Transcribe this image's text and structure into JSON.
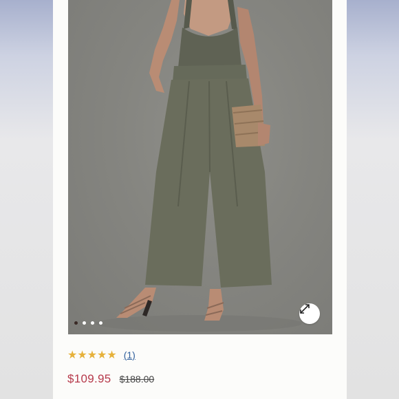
{
  "product": {
    "rating_stars": "★★★★★",
    "review_count": "(1)",
    "sale_price": "$109.95",
    "original_price": "$188.00"
  },
  "gallery": {
    "dot_count": 4,
    "active_dot": 1
  },
  "icons": {
    "zoom": "expand-arrows-icon"
  },
  "colors": {
    "sale_price": "#b6394a",
    "review_link": "#2f5f9c",
    "stars": "#e6b13a"
  }
}
